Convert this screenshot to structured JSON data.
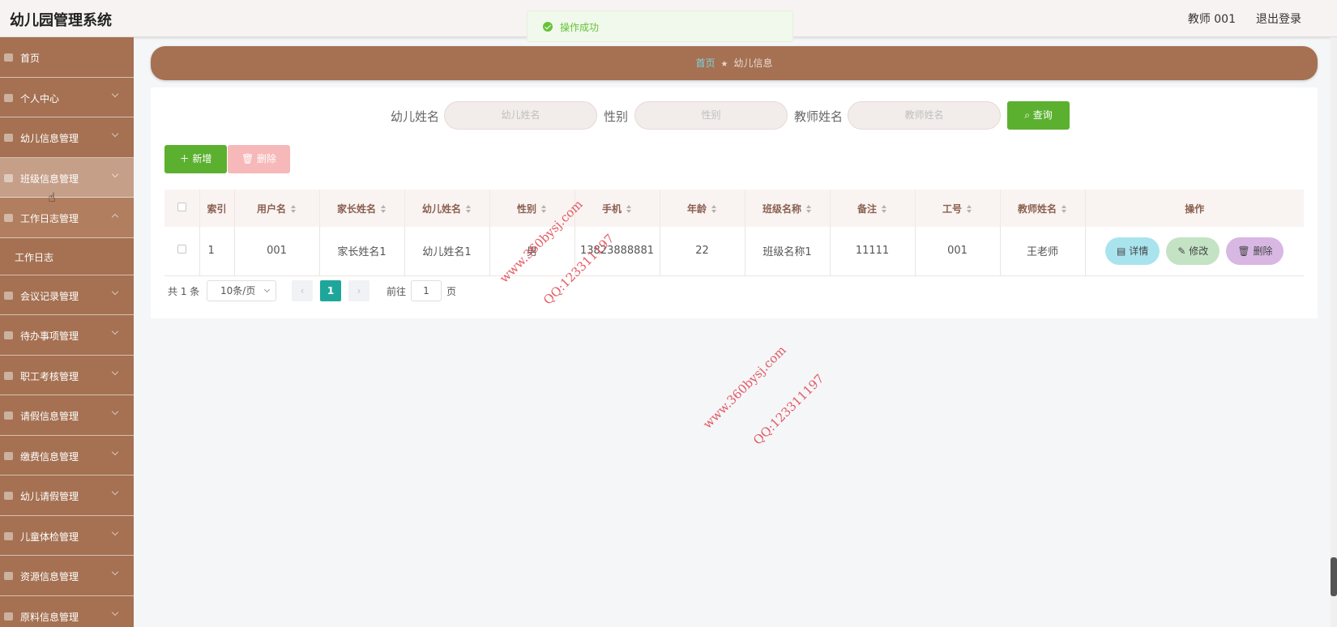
{
  "header": {
    "title": "幼儿园管理系统",
    "user": "教师 001",
    "logout": "退出登录"
  },
  "toast": {
    "message": "操作成功"
  },
  "sidebar": {
    "items": [
      {
        "label": "首页",
        "icon": "home-icon"
      },
      {
        "label": "个人中心",
        "icon": "user-icon"
      },
      {
        "label": "幼儿信息管理",
        "icon": "clipboard-icon"
      },
      {
        "label": "班级信息管理",
        "icon": "card-icon"
      },
      {
        "label": "工作日志管理",
        "icon": "list-icon"
      },
      {
        "label": "工作日志",
        "icon": ""
      },
      {
        "label": "会议记录管理",
        "icon": "mail-icon"
      },
      {
        "label": "待办事项管理",
        "icon": "todo-icon"
      },
      {
        "label": "职工考核管理",
        "icon": "fullscreen-icon"
      },
      {
        "label": "请假信息管理",
        "icon": "menu-icon"
      },
      {
        "label": "缴费信息管理",
        "icon": "mic-icon"
      },
      {
        "label": "幼儿请假管理",
        "icon": "compass-icon"
      },
      {
        "label": "儿童体检管理",
        "icon": "crop-icon"
      },
      {
        "label": "资源信息管理",
        "icon": "chart-icon"
      },
      {
        "label": "原料信息管理",
        "icon": "menu-icon"
      }
    ]
  },
  "breadcrumb": {
    "home": "首页",
    "current": "幼儿信息"
  },
  "search": {
    "child_name_label": "幼儿姓名",
    "child_name_placeholder": "幼儿姓名",
    "gender_label": "性别",
    "gender_placeholder": "性别",
    "teacher_name_label": "教师姓名",
    "teacher_name_placeholder": "教师姓名",
    "query_button": "查询"
  },
  "toolbar": {
    "add_button": "新增",
    "delete_button": "删除"
  },
  "table": {
    "headers": [
      "索引",
      "用户名",
      "家长姓名",
      "幼儿姓名",
      "性别",
      "手机",
      "年龄",
      "班级名称",
      "备注",
      "工号",
      "教师姓名",
      "操作"
    ],
    "rows": [
      {
        "index": "1",
        "username": "001",
        "parent": "家长姓名1",
        "child": "幼儿姓名1",
        "gender": "男",
        "phone": "13823888881",
        "age": "22",
        "class": "班级名称1",
        "note": "11111",
        "employee_no": "001",
        "teacher": "王老师"
      }
    ],
    "row_actions": {
      "detail": "详情",
      "edit": "修改",
      "delete": "删除"
    }
  },
  "pagination": {
    "total": "共 1 条",
    "page_size": "10条/页",
    "current_page": "1",
    "goto_label": "前往",
    "goto_value": "1",
    "page_unit": "页"
  },
  "watermarks": [
    {
      "site": "www.360bysj.com",
      "qq": "QQ:123311197"
    },
    {
      "site": "www.360bysj.com",
      "qq": "QQ:123311197"
    }
  ],
  "colors": {
    "sidebar": "#a57152",
    "primary_green": "#5cb030",
    "active_page": "#1fa69a",
    "toast_text": "#67c23a"
  }
}
